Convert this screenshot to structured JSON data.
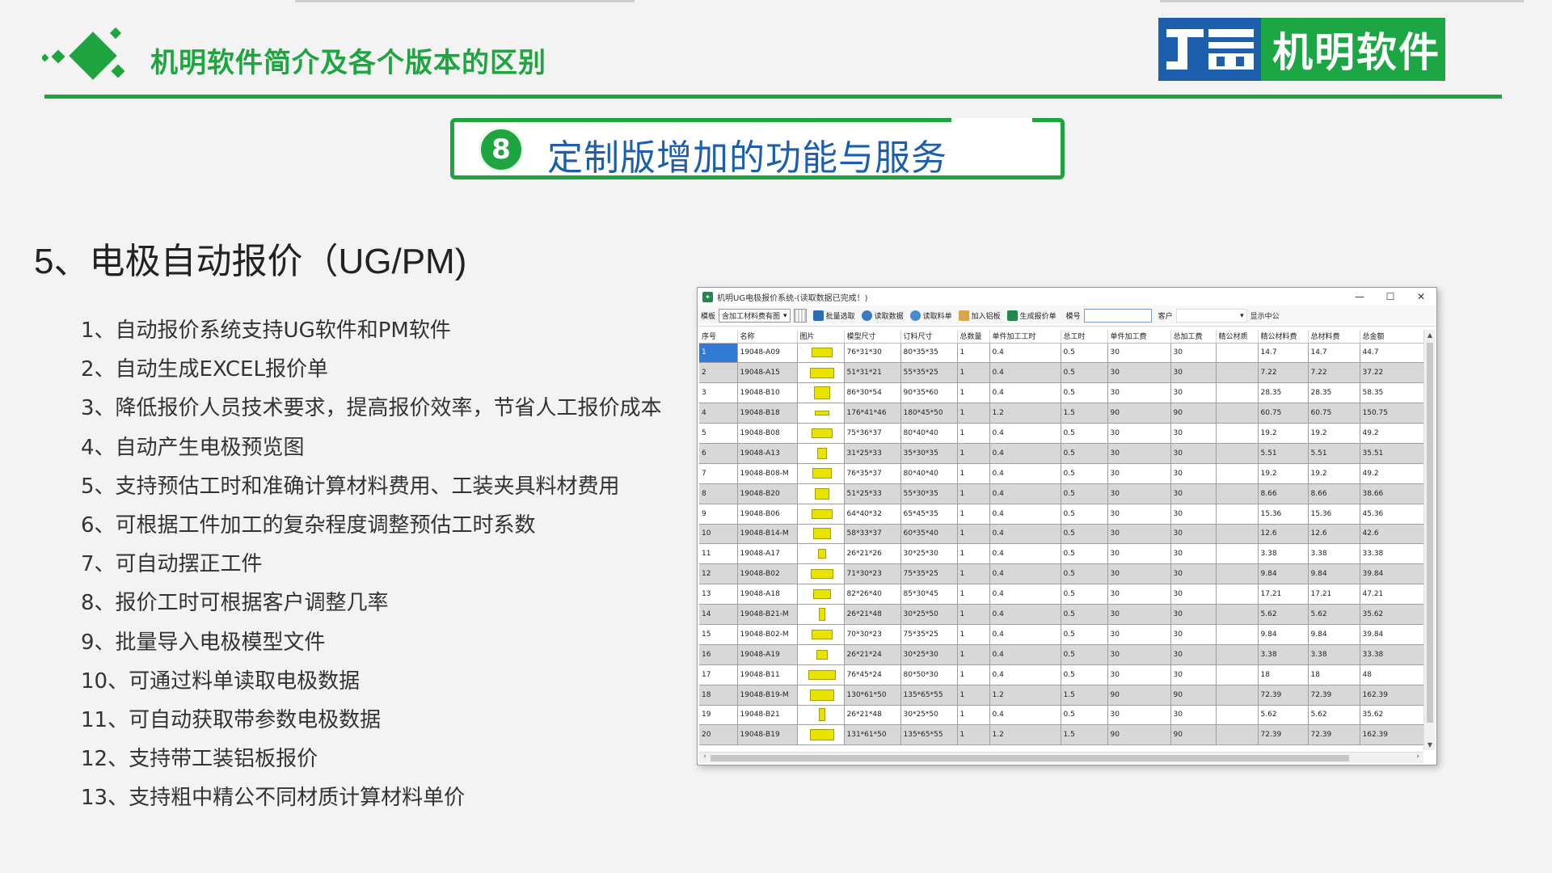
{
  "slide": {
    "title": "机明软件简介及各个版本的区别",
    "brand_name": "机明软件",
    "section_number": "8",
    "section_title": "定制版增加的功能与服务",
    "heading": "5、电极自动报价（UG/PM)"
  },
  "features": [
    "1、自动报价系统支持UG软件和PM软件",
    "2、自动生成EXCEL报价单",
    "3、降低报价人员技术要求，提高报价效率，节省人工报价成本",
    "4、自动产生电极预览图",
    "5、支持预估工时和准确计算材料费用、工装夹具料材费用",
    "6、可根据工件加工的复杂程度调整预估工时系数",
    "7、可自动摆正工件",
    "8、报价工时可根据客户调整几率",
    "9、批量导入电极模型文件",
    "10、可通过料单读取电极数据",
    "11、可自动获取带参数电极数据",
    "12、支持带工装铝板报价",
    "13、支持粗中精公不同材质计算材料单价"
  ],
  "app": {
    "window_title": "机明UG电极报价系统-(读取数据已完成！)",
    "controls": {
      "minimize": "—",
      "maximize": "☐",
      "close": "✕"
    },
    "toolbar": {
      "template_label": "模板",
      "template_value": "含加工材料费有图",
      "batch_select": "批量选取",
      "read_data": "读取数据",
      "read_bom": "读取料单",
      "add_plate": "加入铝板",
      "gen_quote": "生成报价单",
      "mold_no_label": "模号",
      "mold_no_value": "",
      "customer_label": "客户",
      "customer_value": "",
      "show_center": "显示中公"
    },
    "columns": [
      "序号",
      "名称",
      "图片",
      "模型尺寸",
      "订料尺寸",
      "总数量",
      "单件加工工时",
      "总工时",
      "单件加工费",
      "总加工费",
      "精公材质",
      "精公材料费",
      "总材料费",
      "总金额"
    ],
    "rows": [
      [
        "1",
        "19048-A09",
        "",
        "76*31*30",
        "80*35*35",
        "1",
        "0.4",
        "0.5",
        "30",
        "30",
        "",
        "14.7",
        "14.7",
        "44.7"
      ],
      [
        "2",
        "19048-A15",
        "",
        "51*31*21",
        "55*35*25",
        "1",
        "0.4",
        "0.5",
        "30",
        "30",
        "",
        "7.22",
        "7.22",
        "37.22"
      ],
      [
        "3",
        "19048-B10",
        "",
        "86*30*54",
        "90*35*60",
        "1",
        "0.4",
        "0.5",
        "30",
        "30",
        "",
        "28.35",
        "28.35",
        "58.35"
      ],
      [
        "4",
        "19048-B18",
        "",
        "176*41*46",
        "180*45*50",
        "1",
        "1.2",
        "1.5",
        "90",
        "90",
        "",
        "60.75",
        "60.75",
        "150.75"
      ],
      [
        "5",
        "19048-B08",
        "",
        "75*36*37",
        "80*40*40",
        "1",
        "0.4",
        "0.5",
        "30",
        "30",
        "",
        "19.2",
        "19.2",
        "49.2"
      ],
      [
        "6",
        "19048-A13",
        "",
        "31*25*33",
        "35*30*35",
        "1",
        "0.4",
        "0.5",
        "30",
        "30",
        "",
        "5.51",
        "5.51",
        "35.51"
      ],
      [
        "7",
        "19048-B08-M",
        "",
        "76*35*37",
        "80*40*40",
        "1",
        "0.4",
        "0.5",
        "30",
        "30",
        "",
        "19.2",
        "19.2",
        "49.2"
      ],
      [
        "8",
        "19048-B20",
        "",
        "51*25*33",
        "55*30*35",
        "1",
        "0.4",
        "0.5",
        "30",
        "30",
        "",
        "8.66",
        "8.66",
        "38.66"
      ],
      [
        "9",
        "19048-B06",
        "",
        "64*40*32",
        "65*45*35",
        "1",
        "0.4",
        "0.5",
        "30",
        "30",
        "",
        "15.36",
        "15.36",
        "45.36"
      ],
      [
        "10",
        "19048-B14-M",
        "",
        "58*33*37",
        "60*35*40",
        "1",
        "0.4",
        "0.5",
        "30",
        "30",
        "",
        "12.6",
        "12.6",
        "42.6"
      ],
      [
        "11",
        "19048-A17",
        "",
        "26*21*26",
        "30*25*30",
        "1",
        "0.4",
        "0.5",
        "30",
        "30",
        "",
        "3.38",
        "3.38",
        "33.38"
      ],
      [
        "12",
        "19048-B02",
        "",
        "71*30*23",
        "75*35*25",
        "1",
        "0.4",
        "0.5",
        "30",
        "30",
        "",
        "9.84",
        "9.84",
        "39.84"
      ],
      [
        "13",
        "19048-A18",
        "",
        "82*26*40",
        "85*30*45",
        "1",
        "0.4",
        "0.5",
        "30",
        "30",
        "",
        "17.21",
        "17.21",
        "47.21"
      ],
      [
        "14",
        "19048-B21-M",
        "",
        "26*21*48",
        "30*25*50",
        "1",
        "0.4",
        "0.5",
        "30",
        "30",
        "",
        "5.62",
        "5.62",
        "35.62"
      ],
      [
        "15",
        "19048-B02-M",
        "",
        "70*30*23",
        "75*35*25",
        "1",
        "0.4",
        "0.5",
        "30",
        "30",
        "",
        "9.84",
        "9.84",
        "39.84"
      ],
      [
        "16",
        "19048-A19",
        "",
        "26*21*24",
        "30*25*30",
        "1",
        "0.4",
        "0.5",
        "30",
        "30",
        "",
        "3.38",
        "3.38",
        "33.38"
      ],
      [
        "17",
        "19048-B11",
        "",
        "76*45*24",
        "80*50*30",
        "1",
        "0.4",
        "0.5",
        "30",
        "30",
        "",
        "18",
        "18",
        "48"
      ],
      [
        "18",
        "19048-B19-M",
        "",
        "130*61*50",
        "135*65*55",
        "1",
        "1.2",
        "1.5",
        "90",
        "90",
        "",
        "72.39",
        "72.39",
        "162.39"
      ],
      [
        "19",
        "19048-B21",
        "",
        "26*21*48",
        "30*25*50",
        "1",
        "0.4",
        "0.5",
        "30",
        "30",
        "",
        "5.62",
        "5.62",
        "35.62"
      ],
      [
        "20",
        "19048-B19",
        "",
        "131*61*50",
        "135*65*55",
        "1",
        "1.2",
        "1.5",
        "90",
        "90",
        "",
        "72.39",
        "72.39",
        "162.39"
      ]
    ],
    "selected_row": "1"
  },
  "colors": {
    "accent_green": "#1ea53f",
    "brand_blue": "#1d5fad",
    "selection_blue": "#2f7bd6",
    "electrode_yellow": "#e8e300"
  }
}
